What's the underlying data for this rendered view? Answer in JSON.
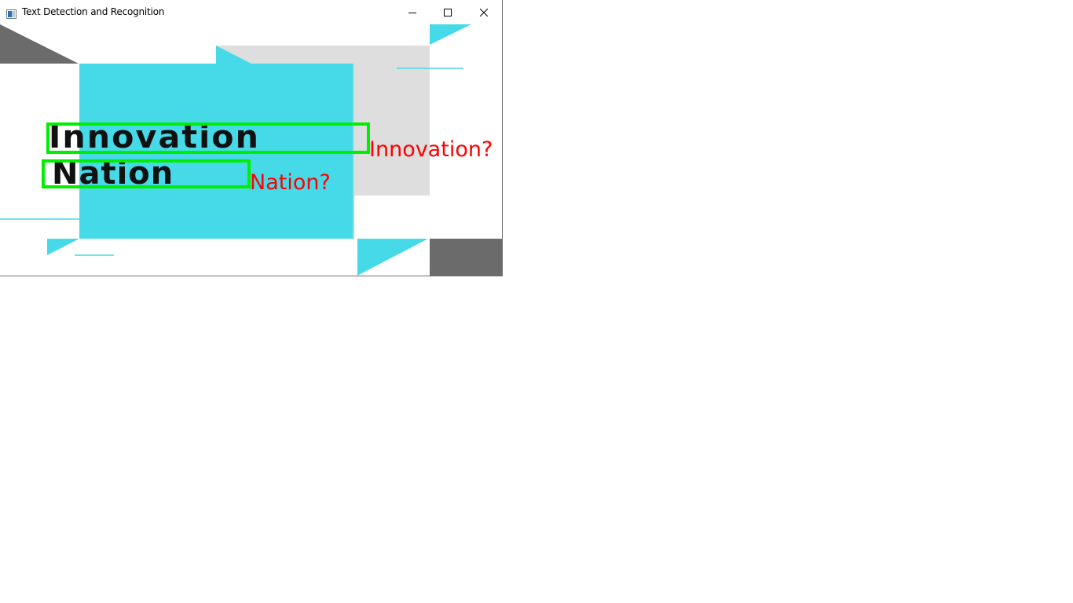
{
  "window": {
    "title": "Text Detection and Recognition",
    "controls": {
      "minimize": "minimize-icon",
      "maximize": "maximize-icon",
      "close": "close-icon"
    }
  },
  "image": {
    "detected_words": [
      "Innovation",
      "Nation"
    ],
    "recognized_labels": [
      "Innovation?",
      "Nation?"
    ],
    "colors": {
      "box": "#00ee00",
      "label": "#ff0000",
      "cyan": "#46dae8",
      "gray": "#6b6b6b",
      "light_gray": "#dedede"
    }
  }
}
